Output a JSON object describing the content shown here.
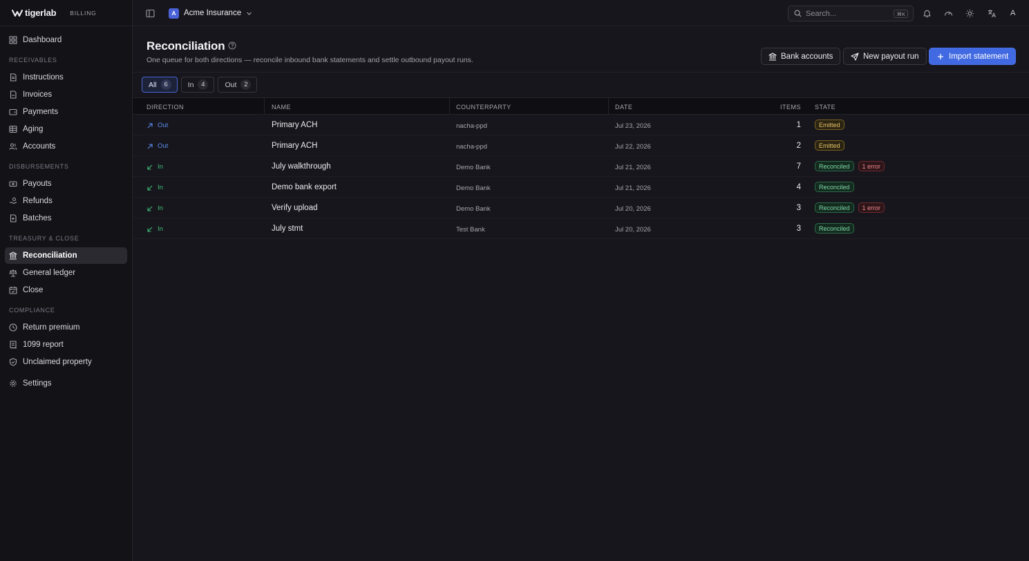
{
  "brand": {
    "name": "tigerlab",
    "tag": "BILLING"
  },
  "sidebar": {
    "dashboard": "Dashboard",
    "receivables": {
      "title": "RECEIVABLES",
      "items": [
        "Instructions",
        "Invoices",
        "Payments",
        "Aging",
        "Accounts"
      ]
    },
    "disbursements": {
      "title": "DISBURSEMENTS",
      "items": [
        "Payouts",
        "Refunds",
        "Batches"
      ]
    },
    "treasury": {
      "title": "TREASURY & CLOSE",
      "items": [
        "Reconciliation",
        "General ledger",
        "Close"
      ]
    },
    "compliance": {
      "title": "COMPLIANCE",
      "items": [
        "Return premium",
        "1099 report",
        "Unclaimed property"
      ]
    },
    "settings": "Settings",
    "active": "Reconciliation"
  },
  "topbar": {
    "org_initial": "A",
    "org_name": "Acme Insurance",
    "search_placeholder": "Search...",
    "search_shortcut": "⌘K",
    "user_initial": "A"
  },
  "page": {
    "title": "Reconciliation",
    "subtitle": "One queue for both directions — reconcile inbound bank statements and settle outbound payout runs.",
    "buttons": {
      "bank_accounts": "Bank accounts",
      "new_payout_run": "New payout run",
      "import_statement": "Import statement"
    }
  },
  "filters": [
    {
      "label": "All",
      "count": "6",
      "active": true
    },
    {
      "label": "In",
      "count": "4",
      "active": false
    },
    {
      "label": "Out",
      "count": "2",
      "active": false
    }
  ],
  "table": {
    "columns": [
      "DIRECTION",
      "NAME",
      "COUNTERPARTY",
      "DATE",
      "ITEMS",
      "STATE"
    ],
    "rows": [
      {
        "direction": "Out",
        "name": "Primary ACH",
        "counterparty": "nacha-ppd",
        "date": "Jul 23, 2026",
        "items": "1",
        "state": "Emitted",
        "error": ""
      },
      {
        "direction": "Out",
        "name": "Primary ACH",
        "counterparty": "nacha-ppd",
        "date": "Jul 22, 2026",
        "items": "2",
        "state": "Emitted",
        "error": ""
      },
      {
        "direction": "In",
        "name": "July walkthrough",
        "counterparty": "Demo Bank",
        "date": "Jul 21, 2026",
        "items": "7",
        "state": "Reconciled",
        "error": "1 error"
      },
      {
        "direction": "In",
        "name": "Demo bank export",
        "counterparty": "Demo Bank",
        "date": "Jul 21, 2026",
        "items": "4",
        "state": "Reconciled",
        "error": ""
      },
      {
        "direction": "In",
        "name": "Verify upload",
        "counterparty": "Demo Bank",
        "date": "Jul 20, 2026",
        "items": "3",
        "state": "Reconciled",
        "error": "1 error"
      },
      {
        "direction": "In",
        "name": "July stmt",
        "counterparty": "Test Bank",
        "date": "Jul 20, 2026",
        "items": "3",
        "state": "Reconciled",
        "error": ""
      }
    ]
  },
  "colors": {
    "accent": "#4169e1",
    "out": "#5b8def",
    "in": "#3fbf78",
    "emitted": "#e8c469",
    "reconciled": "#7fd9a5",
    "error": "#f08a90"
  }
}
